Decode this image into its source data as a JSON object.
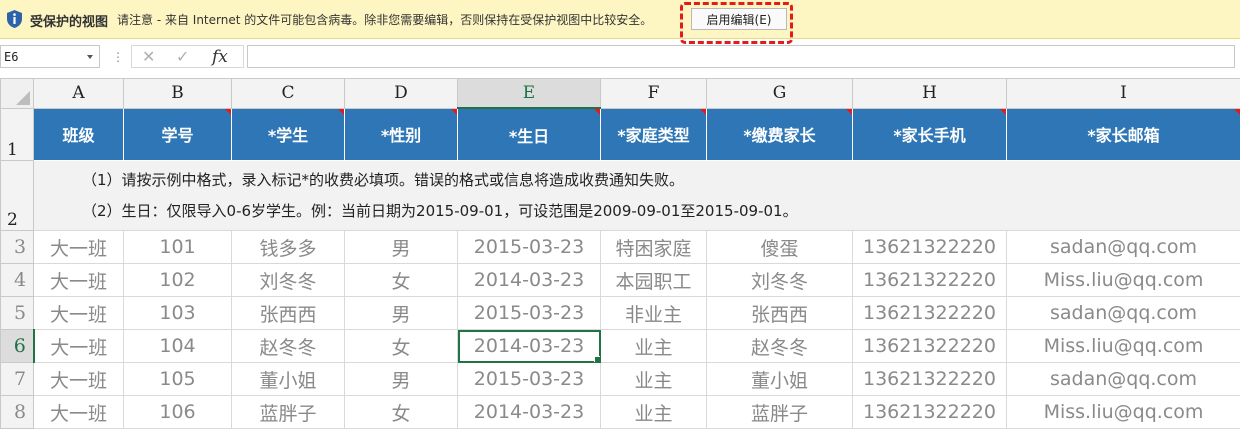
{
  "protected_view": {
    "title": "受保护的视图",
    "message": "请注意 - 来自 Internet 的文件可能包含病毒。除非您需要编辑，否则保持在受保护视图中比较安全。",
    "button_label": "启用编辑(E)"
  },
  "formula_bar": {
    "name_box": "E6",
    "separator": "⋮",
    "cancel_glyph": "✕",
    "enter_glyph": "✓",
    "fx_label": "fx",
    "formula": ""
  },
  "sheet": {
    "columns": [
      "A",
      "B",
      "C",
      "D",
      "E",
      "F",
      "G",
      "H",
      "I"
    ],
    "active_column": "E",
    "active_row": "6",
    "header_row_number": "1",
    "note_row_number": "2",
    "headers": [
      "班级",
      "学号",
      "*学生",
      "*性别",
      "*生日",
      "*家庭类型",
      "*缴费家长",
      "*家长手机",
      "*家长邮箱"
    ],
    "notes": [
      "（1）请按示例中格式，录入标记*的收费必填项。错误的格式或信息将造成收费通知失败。",
      "（2）生日：仅限导入0-6岁学生。例：当前日期为2015-09-01，可设范围是2009-09-01至2015-09-01。"
    ],
    "rows": [
      {
        "num": "3",
        "cells": [
          "大一班",
          "101",
          "钱多多",
          "男",
          "2015-03-23",
          "特困家庭",
          "傻蛋",
          "13621322220",
          "sadan@qq.com"
        ]
      },
      {
        "num": "4",
        "cells": [
          "大一班",
          "102",
          "刘冬冬",
          "女",
          "2014-03-23",
          "本园职工",
          "刘冬冬",
          "13621322220",
          "Miss.liu@qq.com"
        ]
      },
      {
        "num": "5",
        "cells": [
          "大一班",
          "103",
          "张西西",
          "男",
          "2015-03-23",
          "非业主",
          "张西西",
          "13621322220",
          "sadan@qq.com"
        ]
      },
      {
        "num": "6",
        "cells": [
          "大一班",
          "104",
          "赵冬冬",
          "女",
          "2014-03-23",
          "业主",
          "赵冬冬",
          "13621322220",
          "Miss.liu@qq.com"
        ]
      },
      {
        "num": "7",
        "cells": [
          "大一班",
          "105",
          "董小姐",
          "男",
          "2015-03-23",
          "业主",
          "董小姐",
          "13621322220",
          "sadan@qq.com"
        ]
      },
      {
        "num": "8",
        "cells": [
          "大一班",
          "106",
          "蓝胖子",
          "女",
          "2014-03-23",
          "业主",
          "蓝胖子",
          "13621322220",
          "Miss.liu@qq.com"
        ]
      }
    ]
  },
  "colors": {
    "header_fill": "#2e76b5",
    "protected_bar": "#fdf6c3",
    "selection": "#217346",
    "highlight": "#e31b1b"
  },
  "icons": {
    "protected_view": "shield-info-icon",
    "name_box_dropdown": "chevron-down-icon",
    "cancel": "close-icon",
    "enter": "check-icon",
    "function": "function-icon"
  }
}
